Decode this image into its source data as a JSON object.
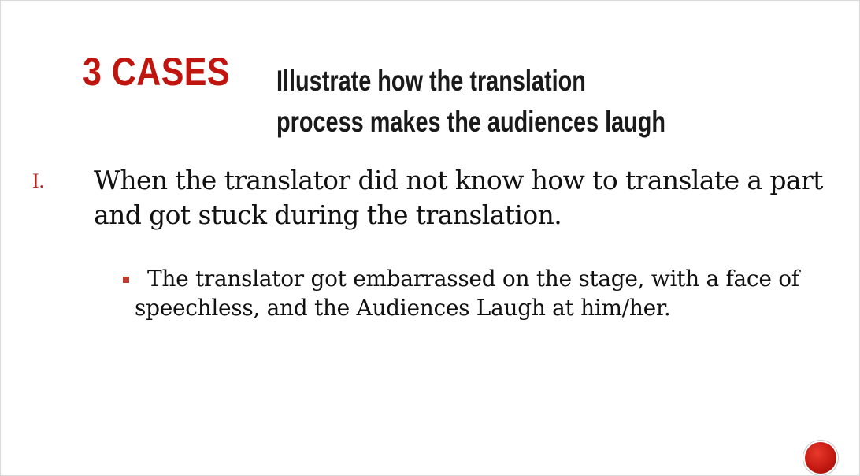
{
  "slide": {
    "title": "3 CASES",
    "subtitle": "Illustrate how the translation process makes the audiences laugh",
    "points": [
      {
        "marker": "I.",
        "text": "When the translator did not know how to translate a part and got stuck during the translation.",
        "subpoints": [
          {
            "text": "The translator got embarrassed on the stage, with a face of speechless, and the Audiences Laugh at him/her."
          }
        ]
      }
    ]
  },
  "colors": {
    "title": "#c0140e",
    "marker": "#b3261e",
    "bullet": "#c0392b",
    "nav_button": "#c41a12",
    "text": "#111111"
  },
  "icons": {
    "bullet": "square-bullet-icon",
    "nav": "red-circle-button-icon"
  }
}
